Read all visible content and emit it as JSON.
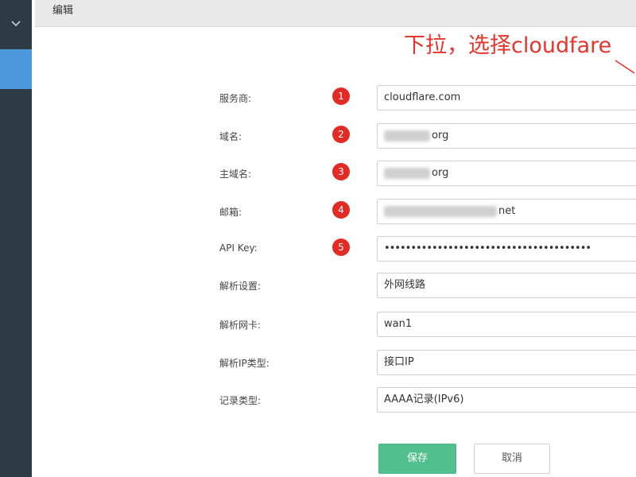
{
  "header": {
    "title": "编辑"
  },
  "annotation": {
    "text": "下拉，选择cloudfare"
  },
  "form": {
    "rows": [
      {
        "label": "服务商:",
        "badge": "1",
        "value": "cloudflare.com"
      },
      {
        "label": "域名:",
        "badge": "2",
        "value": "org"
      },
      {
        "label": "主域名:",
        "badge": "3",
        "value": "org"
      },
      {
        "label": "邮箱:",
        "badge": "4",
        "value": "net"
      },
      {
        "label": "API Key:",
        "badge": "5",
        "value": "•••••••••••••••••••••••••••••••••••••••"
      },
      {
        "label": "解析设置:",
        "value": "外网线路"
      },
      {
        "label": "解析网卡:",
        "value": "wan1"
      },
      {
        "label": "解析IP类型:",
        "value": "接口IP"
      },
      {
        "label": "记录类型:",
        "value": "AAAA记录(IPv6)"
      }
    ]
  },
  "buttons": {
    "save": "保存",
    "cancel": "取消"
  },
  "colors": {
    "sidebar": "#2f3a47",
    "sidebar_active": "#4a97d9",
    "annotation": "#e8342a",
    "badge": "#e32b25",
    "save_button": "#52c08e"
  }
}
